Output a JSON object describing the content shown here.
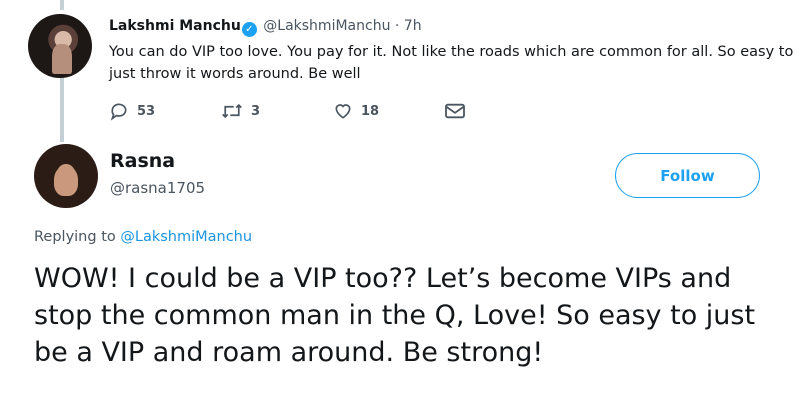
{
  "parent_tweet": {
    "name": "Lakshmi Manchu",
    "handle": "@LakshmiManchu",
    "separator": "·",
    "time": "7h",
    "text": "You can do VIP too love. You pay for it. Not like the roads which are common for all. So easy to just throw it words around. Be well",
    "actions": {
      "replies": "53",
      "retweets": "3",
      "likes": "18"
    },
    "icons": [
      "reply-icon",
      "retweet-icon",
      "like-icon",
      "direct-message-icon",
      "verified-badge-icon"
    ]
  },
  "reply_tweet": {
    "name": "Rasna",
    "handle": "@rasna1705",
    "follow_label": "Follow",
    "replying_prefix": "Replying to",
    "replying_to": "@LakshmiManchu",
    "text": "WOW! I could be a VIP too?? Let’s become VIPs and stop the common man in the Q, Love! So easy to just be a VIP and roam around. Be strong!"
  },
  "colors": {
    "accent": "#1da1f2",
    "mention": "#1b95e0",
    "text_primary": "#14171a",
    "text_secondary": "#4a5560",
    "thread_line": "#c4cfd6"
  }
}
